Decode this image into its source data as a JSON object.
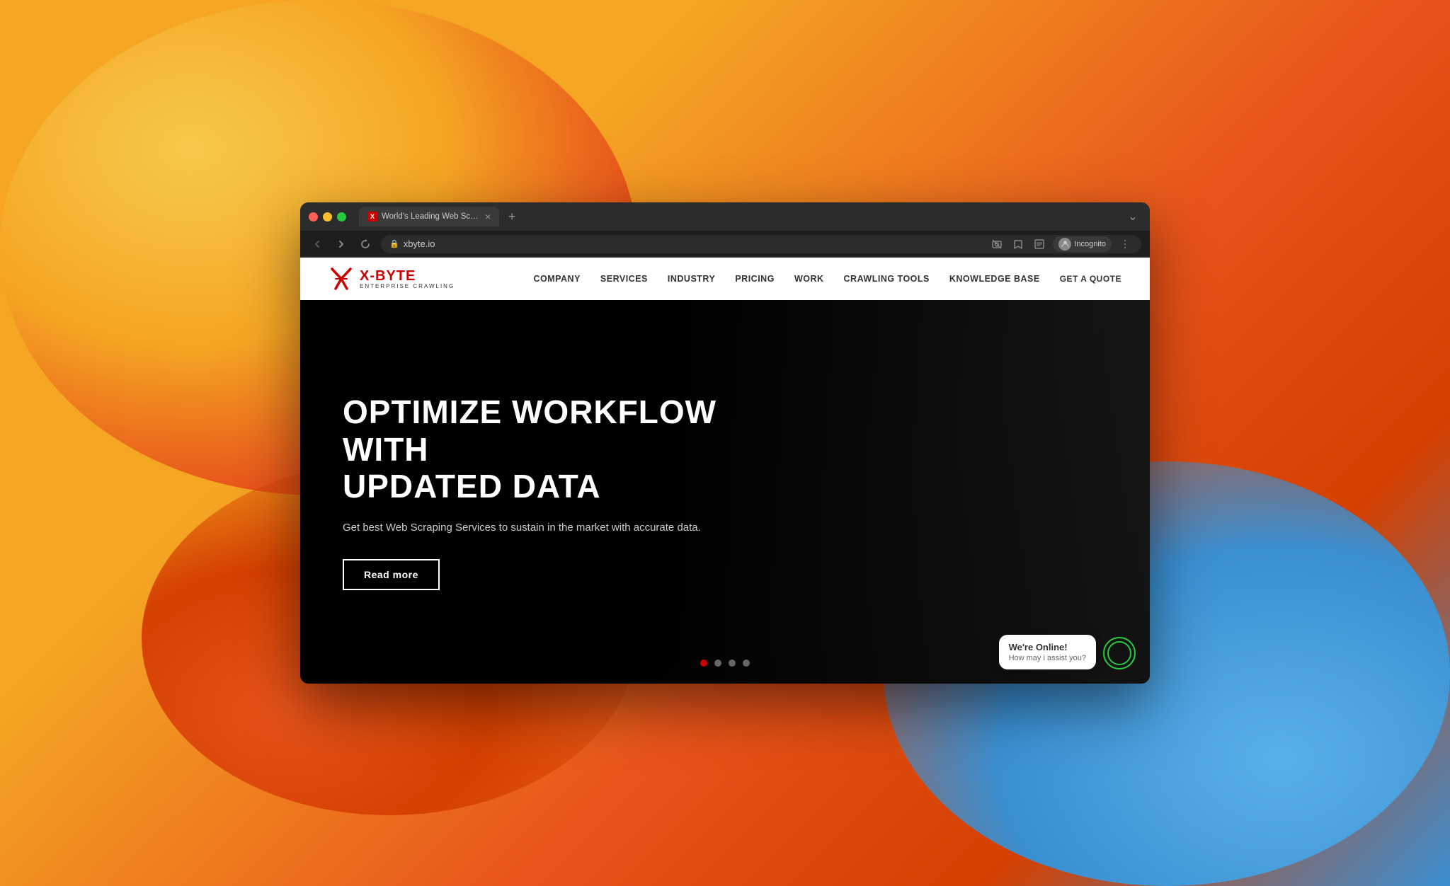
{
  "browser": {
    "tab_title": "World's Leading Web Scraping...",
    "tab_favicon": "X",
    "url": "xbyte.io",
    "incognito_label": "Incognito",
    "nav_back": "‹",
    "nav_forward": "›",
    "nav_refresh": "↻",
    "tab_new": "+",
    "tab_close": "×",
    "tab_menu": "⌄"
  },
  "site": {
    "logo_main": "X-BYTE",
    "logo_sub": "ENTERPRISE CRAWLING",
    "nav_links": [
      {
        "label": "COMPANY"
      },
      {
        "label": "SERVICES"
      },
      {
        "label": "INDUSTRY"
      },
      {
        "label": "PRICING"
      },
      {
        "label": "WORK"
      },
      {
        "label": "CRAWLING TOOLS"
      },
      {
        "label": "KNOWLEDGE BASE"
      },
      {
        "label": "GET A QUOTE"
      }
    ]
  },
  "hero": {
    "title_line1": "OPTIMIZE WORKFLOW WITH",
    "title_line2": "UPDATED DATA",
    "subtitle": "Get best Web Scraping Services to sustain in the market with accurate data.",
    "cta_label": "Read more"
  },
  "carousel": {
    "dots": [
      {
        "active": true
      },
      {
        "active": false
      },
      {
        "active": false
      },
      {
        "active": false
      }
    ]
  },
  "chat": {
    "status": "We're Online!",
    "prompt": "How may i assist you?"
  }
}
